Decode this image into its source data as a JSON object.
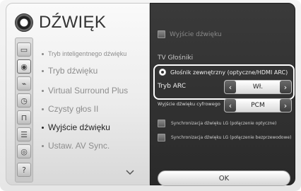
{
  "page": {
    "title": "DŹWIĘK"
  },
  "left_menu": {
    "categories": [
      {
        "icon": "picture-icon"
      },
      {
        "icon": "sound-icon",
        "active": true
      },
      {
        "icon": "channel-icon"
      },
      {
        "icon": "clock-icon"
      },
      {
        "icon": "lock-icon"
      },
      {
        "icon": "option-icon"
      },
      {
        "icon": "network-icon"
      },
      {
        "icon": "support-icon"
      }
    ],
    "items": [
      {
        "label": "Tryb inteligentnego dźwięku",
        "selected": false
      },
      {
        "label": "Tryb dźwięku",
        "selected": false
      },
      {
        "label": "Virtual Surround Plus",
        "selected": false
      },
      {
        "label": "Czysty głos II",
        "selected": false
      },
      {
        "label": "Wyjście dźwięku",
        "selected": true
      },
      {
        "label": "Ustaw. AV Sync.",
        "selected": false
      }
    ]
  },
  "right_panel": {
    "header_label": "Wyjście dźwięku",
    "section_title": "TV Głośniki",
    "external_speaker_label": "Głośnik zewnętrzny (optyczne/HDMI ARC)",
    "arc_mode": {
      "label": "Tryb ARC",
      "value": "Wł."
    },
    "digital_output": {
      "label": "Wyjście dźwięku cyfrowego",
      "value": "PCM"
    },
    "sync_optical_label": "Synchronizacja dźwięku LG (połączenie optyczne)",
    "sync_wireless_label": "Synchronizacja dźwięku LG (połączenie bezprzewodowe)",
    "ok_label": "OK"
  }
}
